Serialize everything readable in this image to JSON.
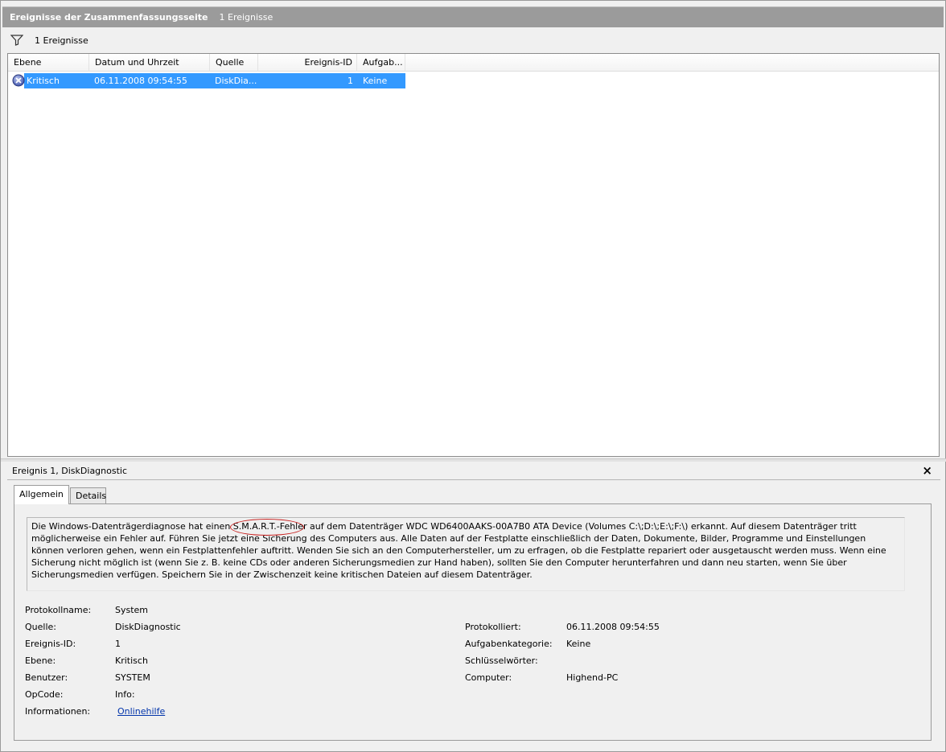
{
  "header": {
    "title": "Ereignisse der Zusammenfassungsseite",
    "count": "1 Ereignisse"
  },
  "filter": {
    "count": "1 Ereignisse",
    "icon": "filter-icon"
  },
  "grid": {
    "columns": [
      "Ebene",
      "Datum und Uhrzeit",
      "Quelle",
      "Ereignis-ID",
      "Aufgab..."
    ],
    "rows": [
      {
        "level": "Kritisch",
        "datetime": "06.11.2008 09:54:55",
        "source": "DiskDia...",
        "event_id": "1",
        "task": "Keine",
        "icon": "critical-icon"
      }
    ]
  },
  "detail": {
    "title": "Ereignis 1, DiskDiagnostic",
    "close": "×",
    "tabs": [
      "Allgemein",
      "Details"
    ],
    "description_before": "Die Windows-Datenträgerdiagnose hat einen ",
    "description_highlight": "S.M.A.R.T.-Fehler",
    "description_after": " auf dem Datenträger WDC WD6400AAKS-00A7B0 ATA Device (Volumes C:\\;D:\\;E:\\;F:\\) erkannt. Auf diesem Datenträger tritt möglicherweise ein Fehler auf. Führen Sie jetzt eine Sicherung des Computers aus. Alle Daten auf der Festplatte einschließlich der Daten, Dokumente, Bilder, Programme und Einstellungen können verloren gehen, wenn ein Festplattenfehler auftritt. Wenden Sie sich an den Computerhersteller, um zu erfragen, ob die Festplatte repariert oder ausgetauscht werden muss. Wenn eine Sicherung nicht möglich ist (wenn Sie z. B. keine CDs oder anderen Sicherungsmedien zur Hand haben), sollten Sie den Computer herunterfahren und dann neu starten, wenn Sie über Sicherungsmedien verfügen. Speichern Sie in der Zwischenzeit keine kritischen Dateien auf diesem Datenträger.",
    "left": [
      {
        "label": "Protokollname:",
        "value": "System"
      },
      {
        "label": "Quelle:",
        "value": "DiskDiagnostic"
      },
      {
        "label": "Ereignis-ID:",
        "value": "1"
      },
      {
        "label": "Ebene:",
        "value": "Kritisch"
      },
      {
        "label": "Benutzer:",
        "value": "SYSTEM"
      },
      {
        "label": "OpCode:",
        "value": "Info:"
      },
      {
        "label": "Informationen:",
        "value": "Onlinehilfe"
      }
    ],
    "right": [
      {
        "label": "Protokolliert:",
        "value": "06.11.2008 09:54:55"
      },
      {
        "label": "Aufgabenkategorie:",
        "value": "Keine"
      },
      {
        "label": "Schlüsselwörter:",
        "value": ""
      },
      {
        "label": "Computer:",
        "value": "Highend-PC"
      }
    ]
  }
}
